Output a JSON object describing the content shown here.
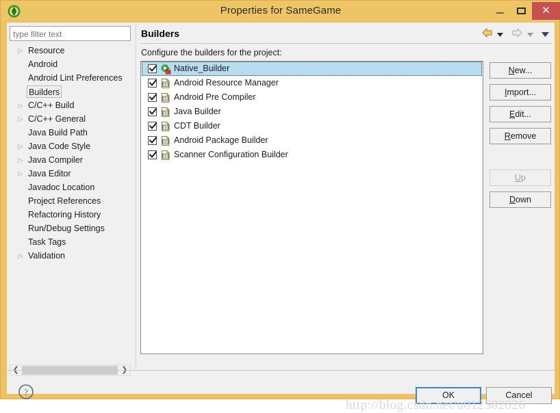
{
  "window": {
    "title": "Properties for SameGame",
    "app_icon": "eclipse-icon",
    "minimize_label": "–",
    "maximize_label": "□",
    "close_label": "✕",
    "titlebar_color": "#eec565",
    "close_button_color": "#c75050"
  },
  "sidebar": {
    "filter": {
      "placeholder": "type filter text",
      "value": ""
    },
    "items": [
      {
        "label": "Resource",
        "expandable": true,
        "selected": false
      },
      {
        "label": "Android",
        "expandable": false,
        "selected": false
      },
      {
        "label": "Android Lint Preferences",
        "expandable": false,
        "selected": false
      },
      {
        "label": "Builders",
        "expandable": false,
        "selected": true
      },
      {
        "label": "C/C++ Build",
        "expandable": true,
        "selected": false
      },
      {
        "label": "C/C++ General",
        "expandable": true,
        "selected": false
      },
      {
        "label": "Java Build Path",
        "expandable": false,
        "selected": false
      },
      {
        "label": "Java Code Style",
        "expandable": true,
        "selected": false
      },
      {
        "label": "Java Compiler",
        "expandable": true,
        "selected": false
      },
      {
        "label": "Java Editor",
        "expandable": true,
        "selected": false
      },
      {
        "label": "Javadoc Location",
        "expandable": false,
        "selected": false
      },
      {
        "label": "Project References",
        "expandable": false,
        "selected": false
      },
      {
        "label": "Refactoring History",
        "expandable": false,
        "selected": false
      },
      {
        "label": "Run/Debug Settings",
        "expandable": false,
        "selected": false
      },
      {
        "label": "Task Tags",
        "expandable": false,
        "selected": false
      },
      {
        "label": "Validation",
        "expandable": true,
        "selected": false
      }
    ],
    "scrollbar": {
      "left_arrow": "❮",
      "right_arrow": "❯"
    }
  },
  "page": {
    "title": "Builders",
    "description": "Configure the builders for the project:",
    "nav": {
      "back_icon": "back-arrow-icon",
      "back_dropdown_icon": "chevron-down-icon",
      "forward_icon": "forward-arrow-icon",
      "forward_dropdown_icon": "chevron-down-icon",
      "menu_icon": "chevron-down-icon",
      "back_enabled": true,
      "forward_enabled": false
    }
  },
  "builders": [
    {
      "label": "Native_Builder",
      "checked": true,
      "selected": true,
      "icon": "native-builder-icon"
    },
    {
      "label": "Android Resource Manager",
      "checked": true,
      "selected": false,
      "icon": "builder-file-icon"
    },
    {
      "label": "Android Pre Compiler",
      "checked": true,
      "selected": false,
      "icon": "builder-file-icon"
    },
    {
      "label": "Java Builder",
      "checked": true,
      "selected": false,
      "icon": "builder-file-icon"
    },
    {
      "label": "CDT Builder",
      "checked": true,
      "selected": false,
      "icon": "builder-file-icon"
    },
    {
      "label": "Android Package Builder",
      "checked": true,
      "selected": false,
      "icon": "builder-file-icon"
    },
    {
      "label": "Scanner Configuration Builder",
      "checked": true,
      "selected": false,
      "icon": "builder-file-icon"
    }
  ],
  "side_buttons": [
    {
      "mnemonic": "N",
      "rest": "ew...",
      "enabled": true,
      "name": "new"
    },
    {
      "mnemonic": "I",
      "rest": "mport...",
      "enabled": true,
      "name": "import"
    },
    {
      "mnemonic": "E",
      "rest": "dit...",
      "enabled": true,
      "name": "edit"
    },
    {
      "mnemonic": "R",
      "rest": "emove",
      "enabled": true,
      "name": "remove"
    },
    {
      "mnemonic": "U",
      "rest": "p",
      "enabled": false,
      "name": "up"
    },
    {
      "mnemonic": "D",
      "rest": "own",
      "enabled": true,
      "name": "down"
    }
  ],
  "footer": {
    "help_icon": "help-question-icon",
    "ok_label": "OK",
    "cancel_label": "Cancel",
    "watermark": "http://blog.csdn.net/u012582826"
  }
}
